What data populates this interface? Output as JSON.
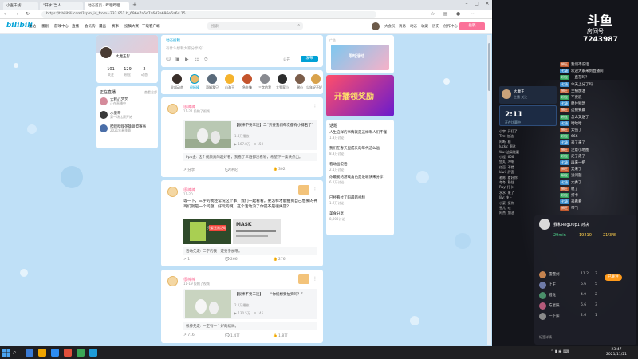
{
  "browser": {
    "tabs": [
      {
        "label": "小查干线！"
      },
      {
        "label": "“开水”当人…"
      },
      {
        "label": "动态首页 - 哔哩哔哩"
      }
    ],
    "url": "https://t.bilibili.com/?spm_id_from=333.851.b_696e7a6d7a6d7a696e6a6d.15"
  },
  "site": {
    "logo": "bilibili",
    "nav": [
      "主站",
      "番剧",
      "游戏中心",
      "直播",
      "会员购",
      "漫画",
      "赛事",
      "投稿大赛",
      "下载客户端"
    ],
    "search_placeholder": "搜索",
    "right_nav": [
      "大会员",
      "消息",
      "动态",
      "收藏",
      "历史",
      "创作中心"
    ],
    "upload": "投稿"
  },
  "user_panel": {
    "name": "大魔王影",
    "stats": [
      {
        "value": "101",
        "label": "关注"
      },
      {
        "value": "129",
        "label": "粉丝"
      },
      {
        "value": "2",
        "label": "动态"
      }
    ]
  },
  "live_panel": {
    "title": "正在直播",
    "more": "查看全部",
    "items": [
      {
        "name": "大程心艺艺",
        "status": "正在直播中"
      },
      {
        "name": "水墨哥",
        "status": "第一场比赛开始"
      },
      {
        "name": "哔哩哔哩英雄联盟赛事",
        "status": "2021年春季赛"
      }
    ]
  },
  "composer": {
    "tab": "动态投稿",
    "placeholder": "有什么想和大家分享的?",
    "visibility": "公开",
    "publish": "发布"
  },
  "follow_bar": [
    {
      "name": "全部动态",
      "color": "#3a2f2a"
    },
    {
      "name": "很棒棒",
      "color": "#e7b96b"
    },
    {
      "name": "哥姆我只",
      "color": "#5a6a7a"
    },
    {
      "name": "山海王",
      "color": "#f5b32d"
    },
    {
      "name": "急先锋",
      "color": "#c4542c"
    },
    {
      "name": "三字的我",
      "color": "#888a90"
    },
    {
      "name": "大罗家小",
      "color": "#2c2c2c"
    },
    {
      "name": "谢小",
      "color": "#7b5d4a"
    },
    {
      "name": "少年好不好",
      "color": "#d9a24b"
    }
  ],
  "posts": [
    {
      "author": "很棒棒",
      "time": "11-21 投稿了视频",
      "card_title": "【很棒不要三连】二“只要我们每次都有小排名了”",
      "card_meta": "1.3万播放",
      "card_views": "167.8万",
      "card_dm": "150",
      "comment": "Ppu金: 这个视频真的超好看，我看了三遍都没看够，希望下一集快点出。",
      "actions": [
        "分享",
        "评论",
        "302"
      ]
    },
    {
      "author": "很棒棒",
      "time": "11-20",
      "text": "等一下，三字的我经常说这个事，我们一起看看。要怎样才能抽到自己想要的神哥们就是一个问题，好玩的啊。这个活动没了你是不是很失望？",
      "img_label": "只要无限活动",
      "img_badge": "MASK",
      "comment": "活动先走: 三字的我一定要参加哦。",
      "actions": [
        "1",
        "266",
        "276"
      ]
    },
    {
      "author": "很棒棒",
      "time": "11-19 投稿了视频",
      "card_title": "【很棒不要三连】——“你们想要抽奖吗？”",
      "card_meta": "2.1万播放",
      "card_views": "130.5万",
      "card_dm": "145",
      "comment": "很棒先走: 一定有一个好的结局。",
      "actions": [
        "716",
        "1.4万",
        "1.8万"
      ]
    }
  ],
  "right_col": {
    "ad1_label": "广告",
    "ad1_text": "限时活动",
    "ad2_text": "开播领奖励",
    "topics_title": "话题",
    "topics": [
      {
        "title": "人生这样的事情就是这样啊人们不懂",
        "meta": "1.3万讨论"
      },
      {
        "title": "我们在春天里成长的年代这么远",
        "meta": "8.3万讨论"
      },
      {
        "title": "看动画说话",
        "meta": "2.1万讨论"
      },
      {
        "title": "你最爱的游戏角色是谁呢快来分享",
        "meta": "6.1万讨论"
      },
      {
        "title": "已经看过了吗最新视频",
        "meta": "1.2万讨论"
      },
      {
        "title": "美食分享",
        "meta": "8,000讨论"
      }
    ]
  },
  "douyu": {
    "logo": "斗鱼",
    "room_label": "房间号",
    "room_no": "7243987",
    "timer": "2:11",
    "timer_label": "正在比赛中",
    "host_label": "大魔王",
    "host_sub": "主播 关注",
    "pk_status": "我和RegD0p1 对决",
    "pk_stats": [
      "29min",
      "19210",
      "21/3/8"
    ],
    "pk_btn": "已关注",
    "pk_rows": [
      {
        "name": "雷霆剑",
        "v1": "11.2",
        "v2": "3"
      },
      {
        "name": "上王",
        "v1": "6.6",
        "v2": "5"
      },
      {
        "name": "潜龙",
        "v1": "4.9",
        "v2": "2"
      },
      {
        "name": "方星辰",
        "v1": "6.6",
        "v2": "3"
      },
      {
        "name": "一下知",
        "v1": "2.6",
        "v2": "1"
      }
    ],
    "pk_footer": "标签详情",
    "chat": [
      {
        "badge": "狮王",
        "bc": "#c25a2e",
        "text": "我们不说话"
      },
      {
        "badge": "七级",
        "bc": "#3d8fcf",
        "text": "欢迎大家来到直播间"
      },
      {
        "badge": "粉丝",
        "bc": "#2fa35a",
        "text": "一直在吗？"
      },
      {
        "badge": "七级",
        "bc": "#3d8fcf",
        "text": "今天上分了吗"
      },
      {
        "badge": "狮王",
        "bc": "#c25a2e",
        "text": "主播加油"
      },
      {
        "badge": "粉丝",
        "bc": "#2fa35a",
        "text": "不要浪"
      },
      {
        "badge": "七级",
        "bc": "#3d8fcf",
        "text": "稳住别急"
      },
      {
        "badge": "狮王",
        "bc": "#c25a2e",
        "text": "这把要赢"
      },
      {
        "badge": "粉丝",
        "bc": "#2fa35a",
        "text": "怎么又送了"
      },
      {
        "badge": "七级",
        "bc": "#3d8fcf",
        "text": "哈哈哈"
      },
      {
        "badge": "狮王",
        "bc": "#c25a2e",
        "text": "太强了"
      },
      {
        "badge": "粉丝",
        "bc": "#2fa35a",
        "text": "666"
      },
      {
        "badge": "七级",
        "bc": "#3d8fcf",
        "text": "来了来了"
      },
      {
        "badge": "狮王",
        "bc": "#c25a2e",
        "text": "注意小地图"
      },
      {
        "badge": "粉丝",
        "bc": "#2fa35a",
        "text": "走了走了"
      },
      {
        "badge": "七级",
        "bc": "#3d8fcf",
        "text": "再来一把"
      },
      {
        "badge": "狮王",
        "bc": "#c25a2e",
        "text": "又来了"
      },
      {
        "badge": "粉丝",
        "bc": "#2fa35a",
        "text": "没问题"
      },
      {
        "badge": "七级",
        "bc": "#3d8fcf",
        "text": "太秀了"
      },
      {
        "badge": "狮王",
        "bc": "#c25a2e",
        "text": "稳了"
      },
      {
        "badge": "粉丝",
        "bc": "#2fa35a",
        "text": "打卡"
      },
      {
        "badge": "七级",
        "bc": "#3d8fcf",
        "text": "来看看"
      },
      {
        "badge": "狮王",
        "bc": "#c25a2e",
        "text": "带飞"
      }
    ],
    "left_chat": [
      "小宇: 开打了",
      "Tim: 加油",
      "阿断: 稳",
      "lucky: 啊这",
      "Wu: 这局能赢",
      "小程: 666",
      "鱼丸: 冲啊",
      "红豆: 不错",
      "kiwi: 厉害",
      "老陈: 看好你",
      "冬冬: 稳住",
      "Ray: 打卡",
      "水水: 来了",
      "lily: 快上",
      "小豪: 挺你",
      "雪儿: 哇",
      "阿杰: 加油"
    ]
  },
  "taskbar": {
    "time": "23:47",
    "date": "2021/11/21",
    "icons": [
      "#3a7bd5",
      "#f0a500",
      "#2d8cf0",
      "#e04f3a",
      "#3aa655",
      "#1e9bd7"
    ]
  }
}
